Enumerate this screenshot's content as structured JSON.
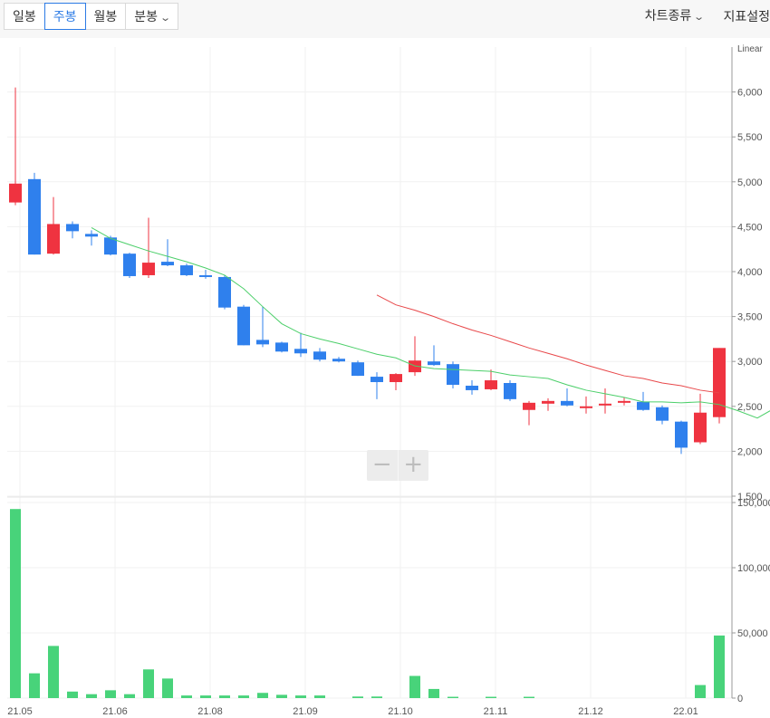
{
  "toolbar": {
    "tabs": [
      {
        "label": "일봉",
        "active": false
      },
      {
        "label": "주봉",
        "active": true
      },
      {
        "label": "월봉",
        "active": false
      },
      {
        "label": "분봉",
        "active": false
      }
    ],
    "chart_type_label": "차트종류",
    "indicator_settings_label": "지표설정"
  },
  "zoom": {
    "minus": "−",
    "plus": "+"
  },
  "colors": {
    "up": "#ef3340",
    "down": "#2f80ed",
    "ma_short": "#4ccf6a",
    "ma_long": "#e8484a",
    "volume": "#48d37a"
  },
  "chart_data": {
    "type": "candlestick",
    "scale_label": "Linear",
    "price_axis": {
      "ticks": [
        "6,000",
        "5,500",
        "5,000",
        "4,500",
        "4,000",
        "3,500",
        "3,000",
        "2,500",
        "2,000",
        "1,500"
      ],
      "ylim": [
        1500,
        6500
      ]
    },
    "volume_axis": {
      "ticks": [
        "150,000",
        "100,000",
        "50,000",
        "0"
      ],
      "ylim": [
        0,
        150000
      ]
    },
    "x_ticks": [
      "21.05",
      "21.06",
      "21.08",
      "21.09",
      "21.10",
      "21.11",
      "21.12",
      "22.01"
    ],
    "candles": [
      {
        "o": 4770,
        "h": 6050,
        "l": 4740,
        "c": 4980
      },
      {
        "o": 5030,
        "h": 5100,
        "l": 4190,
        "c": 4190
      },
      {
        "o": 4200,
        "h": 4830,
        "l": 4190,
        "c": 4530
      },
      {
        "o": 4530,
        "h": 4560,
        "l": 4370,
        "c": 4450
      },
      {
        "o": 4420,
        "h": 4460,
        "l": 4290,
        "c": 4390
      },
      {
        "o": 4380,
        "h": 4400,
        "l": 4180,
        "c": 4190
      },
      {
        "o": 4200,
        "h": 4210,
        "l": 3930,
        "c": 3950
      },
      {
        "o": 3960,
        "h": 4600,
        "l": 3930,
        "c": 4100
      },
      {
        "o": 4110,
        "h": 4360,
        "l": 4060,
        "c": 4070
      },
      {
        "o": 4070,
        "h": 4090,
        "l": 3950,
        "c": 3960
      },
      {
        "o": 3960,
        "h": 4020,
        "l": 3920,
        "c": 3940
      },
      {
        "o": 3940,
        "h": 3960,
        "l": 3580,
        "c": 3600
      },
      {
        "o": 3610,
        "h": 3630,
        "l": 3180,
        "c": 3180
      },
      {
        "o": 3240,
        "h": 3610,
        "l": 3160,
        "c": 3190
      },
      {
        "o": 3210,
        "h": 3220,
        "l": 3100,
        "c": 3110
      },
      {
        "o": 3140,
        "h": 3320,
        "l": 3050,
        "c": 3090
      },
      {
        "o": 3110,
        "h": 3150,
        "l": 3000,
        "c": 3020
      },
      {
        "o": 3030,
        "h": 3050,
        "l": 2990,
        "c": 3000
      },
      {
        "o": 2990,
        "h": 3010,
        "l": 2840,
        "c": 2840
      },
      {
        "o": 2830,
        "h": 2880,
        "l": 2580,
        "c": 2770
      },
      {
        "o": 2770,
        "h": 2870,
        "l": 2680,
        "c": 2860
      },
      {
        "o": 2880,
        "h": 3280,
        "l": 2840,
        "c": 3010
      },
      {
        "o": 3000,
        "h": 3180,
        "l": 2950,
        "c": 2960
      },
      {
        "o": 2970,
        "h": 3000,
        "l": 2700,
        "c": 2740
      },
      {
        "o": 2730,
        "h": 2790,
        "l": 2630,
        "c": 2680
      },
      {
        "o": 2690,
        "h": 2910,
        "l": 2680,
        "c": 2790
      },
      {
        "o": 2760,
        "h": 2790,
        "l": 2560,
        "c": 2580
      },
      {
        "o": 2460,
        "h": 2560,
        "l": 2290,
        "c": 2540
      },
      {
        "o": 2530,
        "h": 2590,
        "l": 2450,
        "c": 2560
      },
      {
        "o": 2560,
        "h": 2700,
        "l": 2500,
        "c": 2510
      },
      {
        "o": 2490,
        "h": 2610,
        "l": 2420,
        "c": 2500
      },
      {
        "o": 2510,
        "h": 2700,
        "l": 2420,
        "c": 2530
      },
      {
        "o": 2540,
        "h": 2600,
        "l": 2510,
        "c": 2560
      },
      {
        "o": 2550,
        "h": 2660,
        "l": 2450,
        "c": 2460
      },
      {
        "o": 2490,
        "h": 2510,
        "l": 2300,
        "c": 2340
      },
      {
        "o": 2330,
        "h": 2340,
        "l": 1970,
        "c": 2040
      },
      {
        "o": 2100,
        "h": 2640,
        "l": 2080,
        "c": 2430
      },
      {
        "o": 2380,
        "h": 3150,
        "l": 2310,
        "c": 3150
      }
    ],
    "volume": [
      145000,
      19000,
      40000,
      5000,
      3000,
      6000,
      3000,
      22000,
      15000,
      2000,
      2000,
      2000,
      2000,
      4000,
      2500,
      2000,
      2000,
      0,
      1200,
      1200,
      0,
      17000,
      7000,
      1000,
      0,
      1000,
      0,
      1000,
      0,
      0,
      0,
      0,
      0,
      0,
      0,
      0,
      10000,
      48000
    ],
    "ma_short": {
      "start_index": 4,
      "values": [
        4490,
        4370,
        4300,
        4230,
        4170,
        4110,
        4040,
        3960,
        3810,
        3610,
        3420,
        3310,
        3250,
        3200,
        3140,
        3080,
        3040,
        2950,
        2920,
        2910,
        2900,
        2890,
        2850,
        2830,
        2810,
        2740,
        2680,
        2640,
        2600,
        2550,
        2550,
        2540,
        2550,
        2520,
        2450,
        2370,
        2490
      ]
    },
    "ma_long": {
      "start_index": 19,
      "values": [
        3740,
        3630,
        3570,
        3500,
        3420,
        3350,
        3290,
        3220,
        3150,
        3090,
        3030,
        2960,
        2900,
        2840,
        2810,
        2760,
        2730,
        2680,
        2650
      ]
    }
  }
}
